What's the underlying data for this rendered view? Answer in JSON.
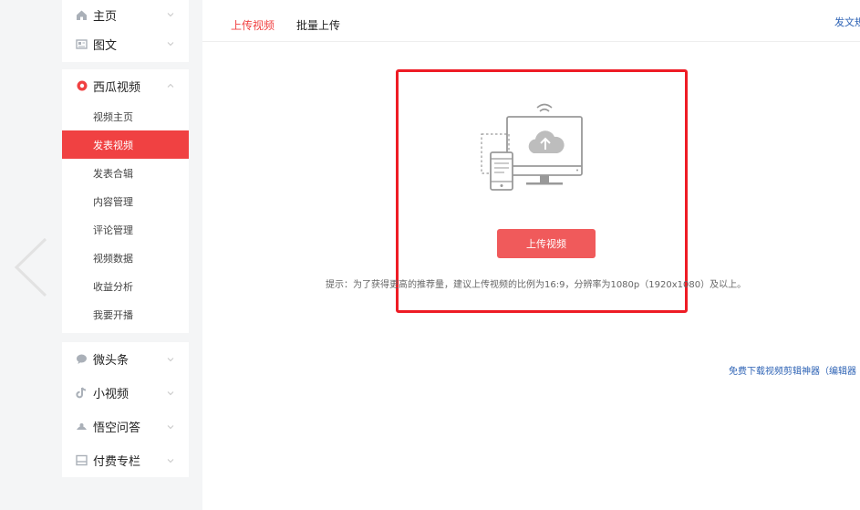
{
  "sidebar": {
    "top_items": [
      {
        "label": "主页",
        "icon": "home-icon"
      },
      {
        "label": "图文",
        "icon": "article-icon"
      }
    ],
    "video_section": {
      "label": "西瓜视频",
      "icon": "xigua-video-icon",
      "items": [
        {
          "label": "视频主页"
        },
        {
          "label": "发表视频",
          "active": true
        },
        {
          "label": "发表合辑"
        },
        {
          "label": "内容管理"
        },
        {
          "label": "评论管理"
        },
        {
          "label": "视频数据"
        },
        {
          "label": "收益分析"
        },
        {
          "label": "我要开播"
        }
      ]
    },
    "bottom_items": [
      {
        "label": "微头条",
        "icon": "weitoutiao-icon"
      },
      {
        "label": "小视频",
        "icon": "short-video-icon"
      },
      {
        "label": "悟空问答",
        "icon": "wukong-qa-icon"
      },
      {
        "label": "付费专栏",
        "icon": "paid-column-icon"
      }
    ]
  },
  "tabs": {
    "upload": "上传视频",
    "batch": "批量上传"
  },
  "header_link": "发文规",
  "upload": {
    "button": "上传视频",
    "hint": "提示：为了获得更高的推荐量，建议上传视频的比例为16:9，分辨率为1080p（1920x1080）及以上。"
  },
  "download_link": "免费下载视频剪辑神器（编辑器",
  "colors": {
    "accent": "#f04142",
    "highlight_border": "#ee1c25",
    "link": "#2e63b5"
  }
}
